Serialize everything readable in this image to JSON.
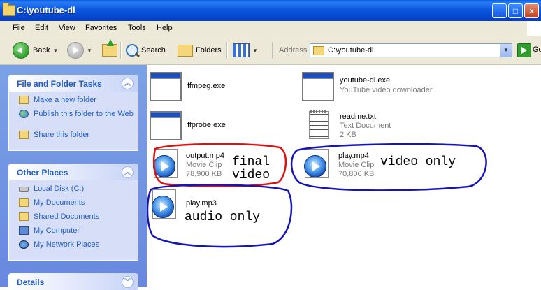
{
  "window": {
    "title": "C:\\youtube-dl",
    "controls": [
      "_",
      "□",
      "×"
    ]
  },
  "menubar": {
    "items": [
      "File",
      "Edit",
      "View",
      "Favorites",
      "Tools",
      "Help"
    ]
  },
  "toolbar": {
    "back_label": "Back",
    "search_label": "Search",
    "folders_label": "Folders",
    "address_label": "Address",
    "address_value": "C:\\youtube-dl",
    "go_label": "Go"
  },
  "sidebar": {
    "file_tasks": {
      "title": "File and Folder Tasks",
      "items": [
        "Make a new folder",
        "Publish this folder to the Web",
        "Share this folder"
      ]
    },
    "other_places": {
      "title": "Other Places",
      "items": [
        "Local Disk (C:)",
        "My Documents",
        "Shared Documents",
        "My Computer",
        "My Network Places"
      ]
    },
    "details": {
      "title": "Details"
    }
  },
  "files": [
    {
      "name": "ffmpeg.exe",
      "type": "",
      "size": "",
      "icon": "application-window-icon"
    },
    {
      "name": "youtube-dl.exe",
      "type": "YouTube video downloader",
      "size": "",
      "icon": "application-window-icon"
    },
    {
      "name": "ffprobe.exe",
      "type": "",
      "size": "",
      "icon": "application-window-icon"
    },
    {
      "name": "readme.txt",
      "type": "Text Document",
      "size": "2 KB",
      "icon": "text-document-icon"
    },
    {
      "name": "output.mp4",
      "type": "Movie Clip",
      "size": "78,900 KB",
      "icon": "media-file-icon"
    },
    {
      "name": "play.mp4",
      "type": "Movie Clip",
      "size": "70,806 KB",
      "icon": "media-file-icon"
    },
    {
      "name": "play.mp3",
      "type": "",
      "size": "",
      "icon": "media-file-icon"
    }
  ],
  "annotations": {
    "output": "final\nvideo",
    "video": "video only",
    "audio": "audio only",
    "colors": {
      "red": "#e01010",
      "blue": "#1414b8"
    }
  }
}
